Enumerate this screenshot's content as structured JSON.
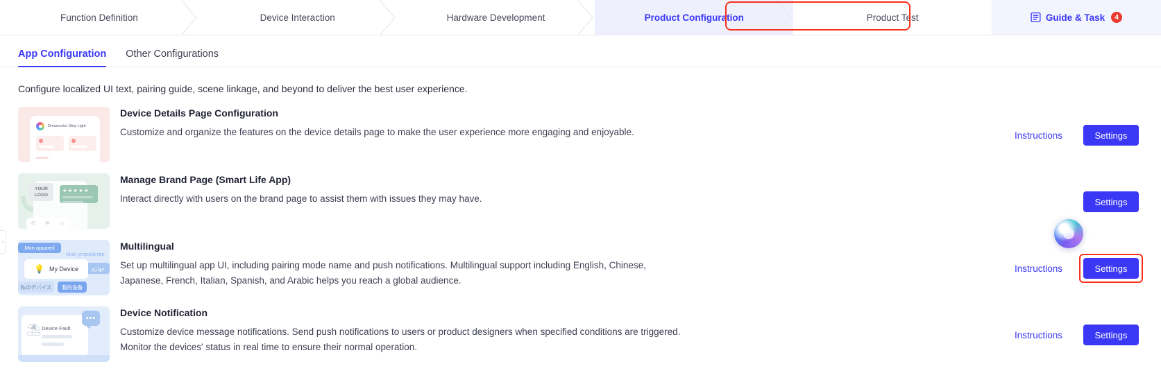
{
  "stepnav": {
    "steps": [
      {
        "label": "Function Definition",
        "active": false
      },
      {
        "label": "Device Interaction",
        "active": false
      },
      {
        "label": "Hardware Development",
        "active": false
      },
      {
        "label": "Product Configuration",
        "active": true
      },
      {
        "label": "Product Test",
        "active": false
      }
    ],
    "guide": {
      "label": "Guide & Task",
      "badge": "4",
      "icon": "document-list-icon"
    },
    "highlight_color": "#f8301a",
    "accent_color": "#3a38f5"
  },
  "subtabs": [
    {
      "label": "App Configuration",
      "selected": true
    },
    {
      "label": "Other Configurations",
      "selected": false
    }
  ],
  "intro": "Configure localized UI text, pairing guide, scene linkage, and beyond to deliver the best user experience.",
  "rows": [
    {
      "title": "Device Details Page Configuration",
      "desc": "Customize and organize the features on the device details page to make the user experience more engaging and enjoyable.",
      "instructions_label": "Instructions",
      "has_instructions": true,
      "settings_label": "Settings",
      "highlighted": false,
      "thumb": {
        "kind": "device-details-thumbnail",
        "device_name": "Dreamcolor Strip Light"
      }
    },
    {
      "title": "Manage Brand Page (Smart Life App)",
      "desc": "Interact directly with users on the brand page to assist them with issues they may have.",
      "instructions_label": "",
      "has_instructions": false,
      "settings_label": "Settings",
      "highlighted": false,
      "thumb": {
        "kind": "brand-page-thumbnail",
        "logo_line1": "YOUR",
        "logo_line2": "LOGO",
        "stars": "★★★★★"
      }
    },
    {
      "title": "Multilingual",
      "desc": "Set up multilingual app UI, including pairing mode name and push notifications. Multilingual support including English, Chinese, Japanese, French, Italian, Spanish, and Arabic helps you reach a global audience.",
      "instructions_label": "Instructions",
      "has_instructions": true,
      "settings_label": "Settings",
      "highlighted": true,
      "thumb": {
        "kind": "multilingual-thumbnail",
        "fr": "Mon appareil",
        "ru": "Мое устройство",
        "ar": "جهازي",
        "ja": "私のデバイス",
        "zh": "我的设备",
        "en": "My Device"
      }
    },
    {
      "title": "Device Notification",
      "desc": "Customize device message notifications. Send push notifications to users or product designers when specified conditions are triggered. Monitor the devices' status in real time to ensure their normal operation.",
      "instructions_label": "Instructions",
      "has_instructions": true,
      "settings_label": "Settings",
      "highlighted": false,
      "thumb": {
        "kind": "device-notification-thumbnail",
        "fault_label": "Device Fault",
        "bubble": "•••"
      }
    }
  ],
  "assistant_orb": {
    "name": "ai-assistant-orb"
  },
  "left_rail": {
    "glyph": "›"
  }
}
